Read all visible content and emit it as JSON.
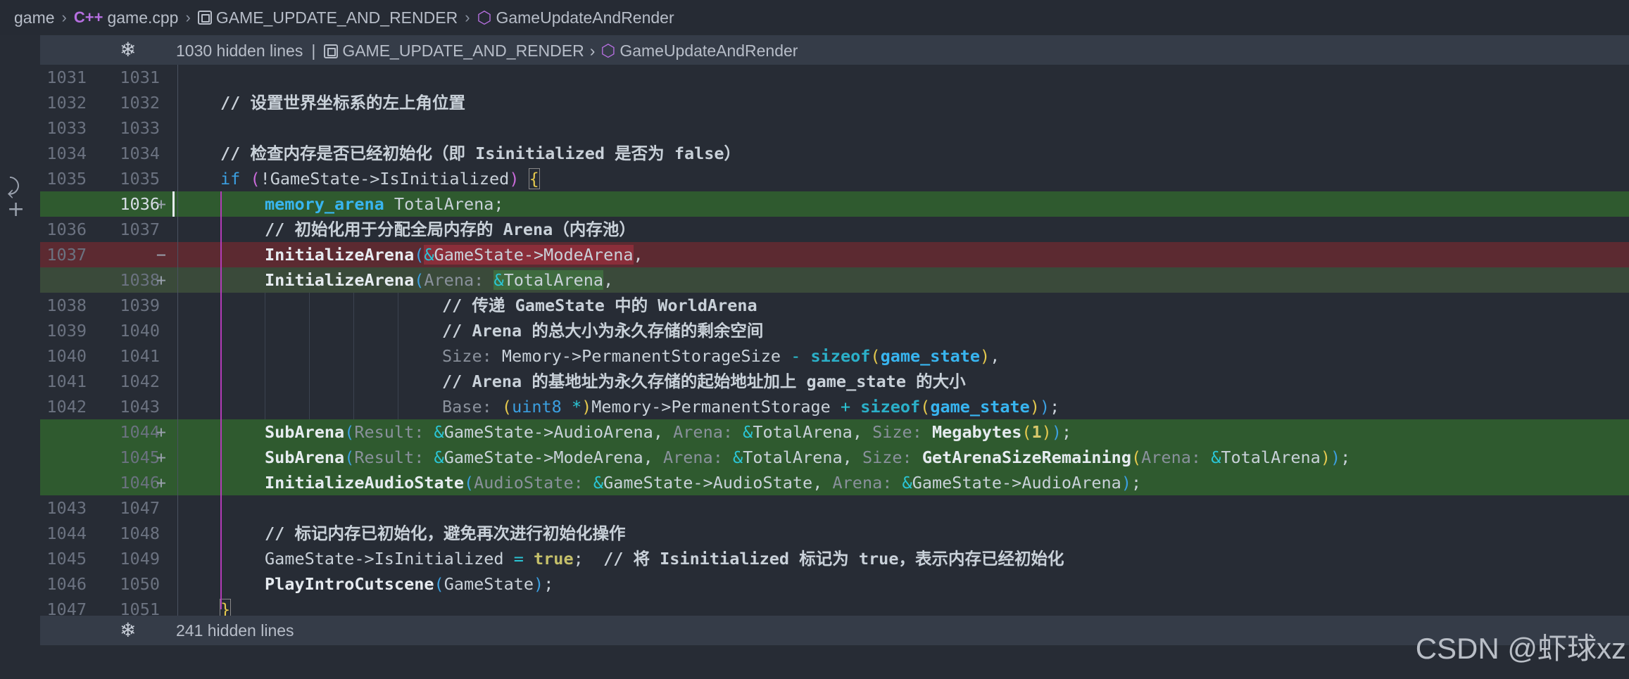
{
  "breadcrumb": {
    "items": [
      "game",
      "game.cpp",
      "GAME_UPDATE_AND_RENDER",
      "GameUpdateAndRender"
    ]
  },
  "fold_top": {
    "text": "1030 hidden lines",
    "path": [
      "GAME_UPDATE_AND_RENDER",
      "GameUpdateAndRender"
    ]
  },
  "fold_bottom": {
    "text": "241 hidden lines"
  },
  "lines": [
    {
      "ln1": "1031",
      "ln2": "1031",
      "mark": "",
      "bg": ""
    },
    {
      "ln1": "1032",
      "ln2": "1032",
      "mark": "",
      "bg": ""
    },
    {
      "ln1": "1033",
      "ln2": "1033",
      "mark": "",
      "bg": ""
    },
    {
      "ln1": "1034",
      "ln2": "1034",
      "mark": "",
      "bg": ""
    },
    {
      "ln1": "1035",
      "ln2": "1035",
      "mark": "",
      "bg": ""
    },
    {
      "ln1": "",
      "ln2": "1036",
      "mark": "+",
      "bg": "add"
    },
    {
      "ln1": "1036",
      "ln2": "1037",
      "mark": "",
      "bg": ""
    },
    {
      "ln1": "1037",
      "ln2": "",
      "mark": "−",
      "bg": "del"
    },
    {
      "ln1": "",
      "ln2": "1038",
      "mark": "+",
      "bg": "mod"
    },
    {
      "ln1": "1038",
      "ln2": "1039",
      "mark": "",
      "bg": ""
    },
    {
      "ln1": "1039",
      "ln2": "1040",
      "mark": "",
      "bg": ""
    },
    {
      "ln1": "1040",
      "ln2": "1041",
      "mark": "",
      "bg": ""
    },
    {
      "ln1": "1041",
      "ln2": "1042",
      "mark": "",
      "bg": ""
    },
    {
      "ln1": "1042",
      "ln2": "1043",
      "mark": "",
      "bg": ""
    },
    {
      "ln1": "",
      "ln2": "1044",
      "mark": "+",
      "bg": "add"
    },
    {
      "ln1": "",
      "ln2": "1045",
      "mark": "+",
      "bg": "add"
    },
    {
      "ln1": "",
      "ln2": "1046",
      "mark": "+",
      "bg": "add"
    },
    {
      "ln1": "1043",
      "ln2": "1047",
      "mark": "",
      "bg": ""
    },
    {
      "ln1": "1044",
      "ln2": "1048",
      "mark": "",
      "bg": ""
    },
    {
      "ln1": "1045",
      "ln2": "1049",
      "mark": "",
      "bg": ""
    },
    {
      "ln1": "1046",
      "ln2": "1050",
      "mark": "",
      "bg": ""
    },
    {
      "ln1": "1047",
      "ln2": "1051",
      "mark": "",
      "bg": ""
    }
  ],
  "code": {
    "c1032": "// 设置世界坐标系的左上角位置",
    "c1034": "// 检查内存是否已经初始化（即 Isinitialized 是否为 false）",
    "if_kw": "if",
    "if_rest": "!GameState->IsInitialized",
    "t_type": "memory_arena",
    "t_rest": " TotalArena;",
    "c1037": "// 初始化用于分配全局内存的 Arena（内存池）",
    "init_fn": "InitializeArena",
    "del_arg": "GameState->ModeArena",
    "hint_arena": "Arena:",
    "add_arg": "TotalArena",
    "c1039": "// 传递 GameState 中的 WorldArena",
    "c1040": "// Arena 的总大小为永久存储的剩余空间",
    "hint_size": "Size:",
    "size_rest": "Memory->PermanentStorageSize",
    "minus": " - ",
    "sizeof": "sizeof",
    "game_state": "game_state",
    "c1042": "// Arena 的基地址为永久存储的起始地址加上 game_state 的大小",
    "hint_base": "Base:",
    "uint8": "uint8",
    "star": " *",
    "base_rest": "Memory->PermanentStorage",
    "plus": " + ",
    "sub_fn": "SubArena",
    "hint_result": "Result:",
    "audio_arena": "GameState->AudioArena",
    "mode_arena": "GameState->ModeArena",
    "total_arena": "TotalArena",
    "megabytes": "Megabytes",
    "one": "1",
    "remaining_fn": "GetArenaSizeRemaining",
    "init_audio_fn": "InitializeAudioState",
    "hint_audiostate": "AudioState:",
    "audio_state": "GameState->AudioState",
    "c1048": "// 标记内存已初始化，避免再次进行初始化操作",
    "set_init": "GameState->IsInitialized",
    "eq": " = ",
    "true_kw": "true",
    "c1049": "// 将 Isinitialized 标记为 true，表示内存已经初始化",
    "play_fn": "PlayIntroCutscene",
    "play_arg": "GameState",
    "close_brace": "}"
  },
  "watermark": "CSDN @虾球xz",
  "colors": {
    "background": "#272c35",
    "added": "#2f5a2f",
    "deleted": "#5c2a31",
    "keyword": "#3b9fe0",
    "scope_guide": "#b13bb7"
  }
}
